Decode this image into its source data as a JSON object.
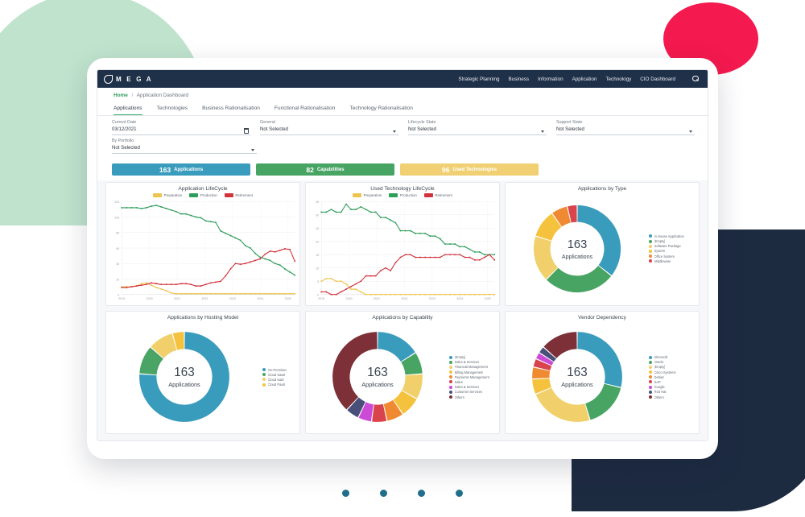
{
  "header": {
    "logo_text": "M E G A",
    "nav": [
      {
        "label": "Strategic Planning"
      },
      {
        "label": "Business"
      },
      {
        "label": "Information"
      },
      {
        "label": "Application"
      },
      {
        "label": "Technology"
      },
      {
        "label": "CIO Dashboard"
      }
    ]
  },
  "breadcrumb": {
    "home": "Home",
    "separator": "/",
    "current": "Application Dashboard"
  },
  "tabs": [
    {
      "label": "Applications",
      "active": true
    },
    {
      "label": "Technologies",
      "active": false
    },
    {
      "label": "Business Rationalisation",
      "active": false
    },
    {
      "label": "Functional Rationalisation",
      "active": false
    },
    {
      "label": "Technology Rationalisation",
      "active": false
    }
  ],
  "filters": {
    "current_date": {
      "label": "Current Date",
      "value": "03/12/2021"
    },
    "general": {
      "label": "General",
      "value": "Not Selected"
    },
    "lifecycle_state": {
      "label": "Lifecycle State",
      "value": "Not Selected"
    },
    "support_state": {
      "label": "Support State",
      "value": "Not Selected"
    },
    "by_portfolio": {
      "label": "By Portfolio",
      "value": "Not Selected"
    }
  },
  "kpis": [
    {
      "number": "163",
      "label": "Applications",
      "color": "#3a9cbd"
    },
    {
      "number": "82",
      "label": "Capabilities",
      "color": "#48a463"
    },
    {
      "number": "96",
      "label": "Used Technologies",
      "color": "#f0d073"
    }
  ],
  "chart_data": [
    {
      "type": "line",
      "title": "Application LifeCycle",
      "xlabel": "",
      "ylabel": "",
      "ylim": [
        0,
        120
      ],
      "yticks": [
        0,
        20,
        40,
        60,
        80,
        100,
        120
      ],
      "xticks": [
        "2019",
        "2020",
        "2021",
        "2022",
        "2023",
        "2024",
        "2025"
      ],
      "grid": true,
      "legend_position": "top",
      "x": [
        "2019.0",
        "2019.2",
        "2019.4",
        "2019.6",
        "2019.8",
        "2020.0",
        "2020.2",
        "2020.4",
        "2020.6",
        "2020.8",
        "2021.0",
        "2021.2",
        "2021.4",
        "2021.6",
        "2021.8",
        "2022.0",
        "2022.2",
        "2022.4",
        "2022.6",
        "2022.8",
        "2023.0",
        "2023.2",
        "2023.4",
        "2023.6",
        "2023.8",
        "2024.0",
        "2024.2",
        "2024.4",
        "2024.6",
        "2024.8",
        "2025.0",
        "2025.2",
        "2025.4",
        "2025.6",
        "2025.8",
        "2026.0"
      ],
      "series": [
        {
          "name": "Preparation",
          "color": "#eec450",
          "values": [
            10,
            10,
            10,
            11,
            14,
            15,
            12,
            9,
            7,
            5,
            2,
            1,
            1,
            1,
            1,
            1,
            1,
            1,
            1,
            1,
            1,
            1,
            1,
            1,
            1,
            1,
            1,
            1,
            1,
            1,
            1,
            1,
            1,
            1,
            1,
            1
          ]
        },
        {
          "name": "Production",
          "color": "#2e9e5b",
          "values": [
            112,
            112,
            112,
            112,
            111,
            112,
            114,
            115,
            113,
            111,
            109,
            107,
            104,
            104,
            102,
            100,
            99,
            95,
            94,
            93,
            82,
            79,
            76,
            73,
            70,
            63,
            60,
            53,
            48,
            46,
            44,
            40,
            38,
            33,
            29,
            25
          ]
        },
        {
          "name": "Retirement",
          "color": "#d1343c",
          "values": [
            9,
            9,
            10,
            11,
            12,
            13,
            15,
            14,
            13,
            13,
            13,
            13,
            14,
            14,
            13,
            11,
            11,
            13,
            15,
            16,
            17,
            24,
            33,
            40,
            39,
            40,
            42,
            44,
            46,
            52,
            56,
            55,
            57,
            59,
            58,
            43
          ]
        }
      ]
    },
    {
      "type": "line",
      "title": "Used Technology LifeCycle",
      "xlabel": "",
      "ylabel": "",
      "ylim": [
        0,
        35
      ],
      "yticks": [
        0,
        5,
        10,
        15,
        20,
        25,
        30,
        35
      ],
      "xticks": [
        "2019",
        "2020",
        "2021",
        "2022",
        "2023",
        "2024",
        "2025"
      ],
      "grid": true,
      "legend_position": "top",
      "x": [
        "2019.0",
        "2019.2",
        "2019.4",
        "2019.6",
        "2019.8",
        "2020.0",
        "2020.2",
        "2020.4",
        "2020.6",
        "2020.8",
        "2021.0",
        "2021.2",
        "2021.4",
        "2021.6",
        "2021.8",
        "2022.0",
        "2022.2",
        "2022.4",
        "2022.6",
        "2022.8",
        "2023.0",
        "2023.2",
        "2023.4",
        "2023.6",
        "2023.8",
        "2024.0",
        "2024.2",
        "2024.4",
        "2024.6",
        "2024.8",
        "2025.0",
        "2025.2",
        "2025.4",
        "2025.6",
        "2025.8",
        "2026.0"
      ],
      "series": [
        {
          "name": "Preparation",
          "color": "#eec450",
          "values": [
            5,
            6,
            6,
            5,
            5,
            4,
            2,
            2,
            1,
            0,
            0,
            0,
            0,
            0,
            0,
            0,
            0,
            0,
            0,
            0,
            0,
            0,
            0,
            0,
            0,
            0,
            0,
            0,
            0,
            0,
            0,
            0,
            0,
            0,
            0,
            0
          ]
        },
        {
          "name": "Production",
          "color": "#2e9e5b",
          "values": [
            31,
            31,
            32,
            31,
            31,
            34,
            32,
            32,
            33,
            32,
            31,
            31,
            29,
            29,
            28,
            27,
            24,
            24,
            24,
            23,
            23,
            23,
            22,
            22,
            21,
            19,
            19,
            19,
            18,
            18,
            17,
            16,
            16,
            15,
            15,
            15
          ]
        },
        {
          "name": "Retirement",
          "color": "#d1343c",
          "values": [
            1,
            1,
            0,
            0,
            1,
            2,
            3,
            4,
            5,
            7,
            7,
            7,
            9,
            10,
            9,
            12,
            14,
            15,
            15,
            14,
            14,
            14,
            14,
            14,
            14,
            15,
            15,
            15,
            15,
            14,
            14,
            13,
            13,
            14,
            15,
            13
          ]
        }
      ]
    },
    {
      "type": "pie",
      "title": "Applications by Type",
      "center_number": "163",
      "center_label": "Applications",
      "legend_position": "right",
      "labels": [
        "In House Application",
        "[Empty]",
        "Software Package",
        "System",
        "Office System",
        "Middleware"
      ],
      "values": [
        58,
        44,
        28,
        17,
        10,
        6
      ],
      "colors": [
        "#3a9cbd",
        "#48a463",
        "#f1d06b",
        "#f5c23e",
        "#ef8a32",
        "#d8434c"
      ]
    },
    {
      "type": "pie",
      "title": "Applications by Hosting Model",
      "center_number": "163",
      "center_label": "Applications",
      "legend_position": "right",
      "labels": [
        "On-Premises",
        "Cloud SaaS",
        "Cloud IaaS",
        "Cloud PaaS"
      ],
      "values": [
        124,
        17,
        15,
        7
      ],
      "colors": [
        "#3a9cbd",
        "#4aa465",
        "#f1d06b",
        "#f5c23e"
      ]
    },
    {
      "type": "pie",
      "title": "Applications by Capability",
      "center_number": "163",
      "center_label": "Applications",
      "legend_position": "right",
      "labels": [
        "[Empty]",
        "Sales & Services",
        "Financial Management",
        "Billing Management",
        "Payments Management",
        "Sales",
        "Sales & Services",
        "Customer Services",
        "Others"
      ],
      "values": [
        26,
        13,
        15,
        12,
        10,
        9,
        8,
        8,
        62
      ],
      "colors": [
        "#3a9cbd",
        "#48a463",
        "#f1d06b",
        "#f5c23e",
        "#ef8a32",
        "#d8434c",
        "#cc4bd6",
        "#48507a",
        "#7d3038"
      ]
    },
    {
      "type": "pie",
      "title": "Vendor Dependency",
      "center_number": "163",
      "center_label": "Applications",
      "legend_position": "right",
      "labels": [
        "Microsoft",
        "Oracle",
        "[Empty]",
        "Cisco Systems",
        "Debian",
        "SAP",
        "Google",
        "Red Hat",
        "Others"
      ],
      "values": [
        47,
        27,
        38,
        9,
        7,
        5,
        4,
        4,
        22
      ],
      "colors": [
        "#3a9cbd",
        "#48a463",
        "#f1d06b",
        "#f5c23e",
        "#ef8a32",
        "#d8434c",
        "#cc4bd6",
        "#48507a",
        "#7d3038"
      ]
    }
  ],
  "carousel": {
    "dots": 4,
    "active_index": 0
  }
}
